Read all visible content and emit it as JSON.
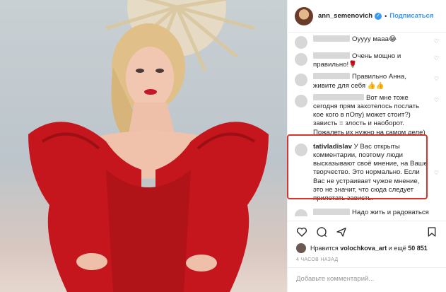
{
  "post": {
    "username": "ann_semenovich",
    "verified_icon": "✓",
    "separator": "•",
    "follow_label": "Подписаться"
  },
  "comments": [
    {
      "user": "",
      "text": "Оуууу мааа😂"
    },
    {
      "user": "",
      "text": "Очень мощно и правильно!🌹"
    },
    {
      "user": "",
      "text": "Правильно Анна, живите для себя 👍👍"
    },
    {
      "user": "",
      "text": "Вот мне тоже сегодня прям захотелось послать кое кого в пОпу) может стоит?) зависть = злость и наоборот. Пожалеть их нужно на самом деле)"
    },
    {
      "user": "tativladislav",
      "text": "У Вас открыты комментарии, поэтому люди высказывают своё мнение, на Ваше творчество. Это нормально. Если Вас не устраивает чужое мнение, это не значит, что сюда следует прилетать зависть."
    },
    {
      "user": "",
      "text": "Надо жить и радоваться для себя. А завистники пусть кипят и"
    }
  ],
  "likes": {
    "prefix": "Нравится",
    "user": "volochkova_art",
    "middle": "и ещё",
    "count": "50 851"
  },
  "time_ago": "4 ЧАСОВ НАЗАД",
  "add_comment_placeholder": "Добавьте комментарий...",
  "icons": {
    "heart": "heart-icon",
    "comment": "comment-icon",
    "share": "share-icon",
    "save": "bookmark-icon"
  },
  "colors": {
    "accent": "#3897f0",
    "highlight": "#d8332c",
    "dress": "#c4161c"
  }
}
